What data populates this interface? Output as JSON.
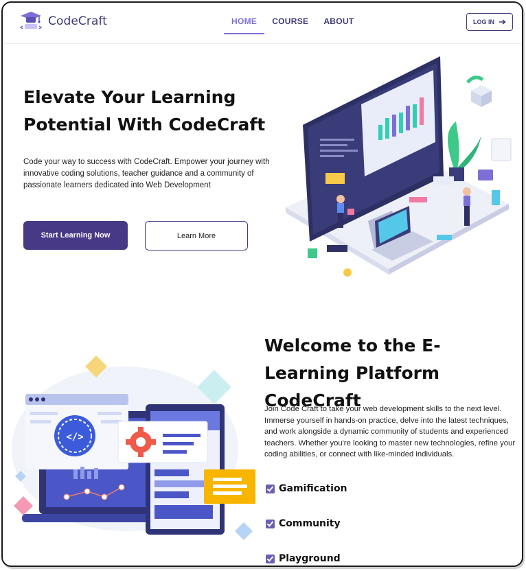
{
  "brand": {
    "name": "CodeCraft",
    "icon": "graduation-cap-icon",
    "color": "#3f3a78"
  },
  "nav": {
    "items": [
      {
        "label": "HOME",
        "active": true
      },
      {
        "label": "COURSE",
        "active": false
      },
      {
        "label": "ABOUT",
        "active": false
      }
    ],
    "login_label": "LOG IN",
    "login_icon": "arrow-right-icon"
  },
  "hero": {
    "title": "Elevate Your Learning Potential With CodeCraft",
    "text": "Code your way to success with CodeCraft. Empower your journey with innovative coding solutions, teacher guidance and a community of passionate learners dedicated into Web Development",
    "primary_button": "Start Learning Now",
    "secondary_button": "Learn More",
    "illustration": "isometric-coding-workspace-illustration"
  },
  "welcome": {
    "title": "Welcome to the E-Learning Platform CodeCraft",
    "text": "Join Code Craft to take your web development skills to the next level. Immerse yourself in hands-on practice, delve into the latest techniques, and work alongside a dynamic community of students and experienced teachers. Whether you're looking to master new technologies, refine your coding abilities, or connect with like-minded individuals.",
    "features": [
      "Gamification",
      "Community",
      "Playground"
    ],
    "illustration": "web-development-screens-illustration"
  },
  "colors": {
    "accent": "#7b6fd6",
    "primary": "#473985",
    "check": "#6a5fb0"
  }
}
